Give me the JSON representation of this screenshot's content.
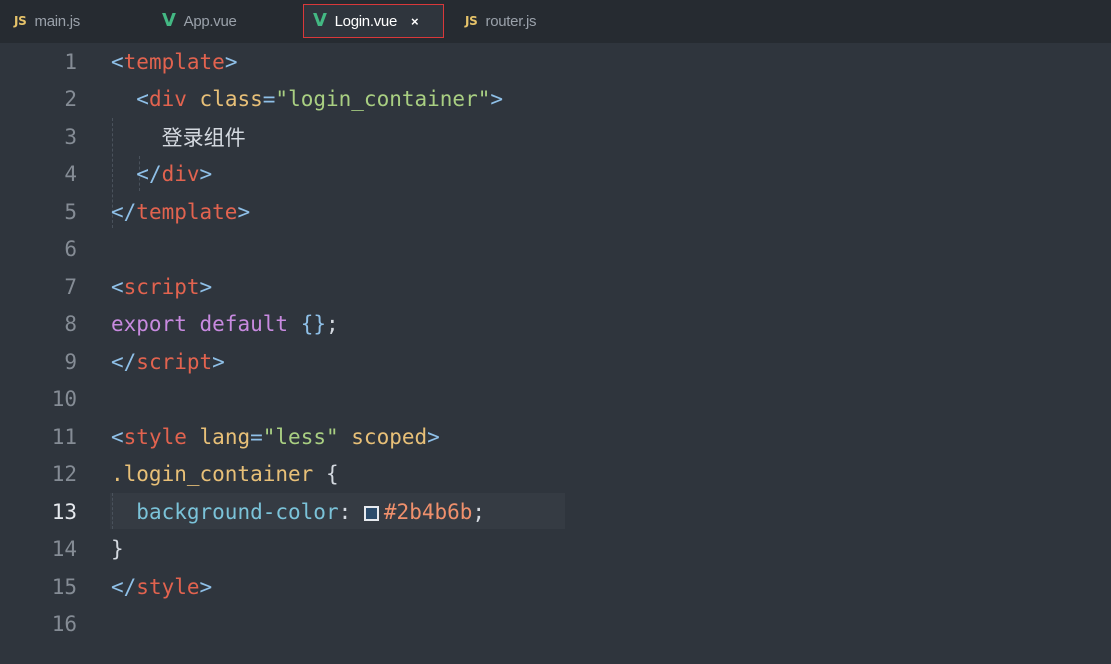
{
  "tabs": [
    {
      "label": "main.js",
      "icon": "JS",
      "active": false
    },
    {
      "label": "App.vue",
      "icon": "V",
      "active": false
    },
    {
      "label": "Login.vue",
      "icon": "V",
      "active": true,
      "close": "×"
    },
    {
      "label": "router.js",
      "icon": "JS",
      "active": false
    }
  ],
  "editor": {
    "current_line": "13",
    "line_numbers": [
      "1",
      "2",
      "3",
      "4",
      "5",
      "6",
      "7",
      "8",
      "9",
      "10",
      "11",
      "12",
      "13",
      "14",
      "15",
      "16"
    ],
    "lines": {
      "l1": {
        "lt": "<",
        "tag": "template",
        "gt": ">"
      },
      "l2": {
        "lt": "<",
        "tag": "div",
        "attr": "class",
        "eq": "=",
        "val": "\"login_container\"",
        "gt": ">"
      },
      "l3": {
        "text": "登录组件"
      },
      "l4": {
        "lt": "</",
        "tag": "div",
        "gt": ">"
      },
      "l5": {
        "lt": "</",
        "tag": "template",
        "gt": ">"
      },
      "l7": {
        "lt": "<",
        "tag": "script",
        "gt": ">"
      },
      "l8": {
        "kw1": "export",
        "kw2": "default",
        "obj": "{}",
        "semi": ";"
      },
      "l9": {
        "lt": "</",
        "tag": "script",
        "gt": ">"
      },
      "l11": {
        "lt": "<",
        "tag": "style",
        "attr1": "lang",
        "eq": "=",
        "val": "\"less\"",
        "attr2": "scoped",
        "gt": ">"
      },
      "l12": {
        "sel": ".login_container",
        "brace": "{"
      },
      "l13": {
        "prop": "background-color",
        "colon": ":",
        "value": "#2b4b6b",
        "semi": ";"
      },
      "l14": {
        "brace": "}"
      },
      "l15": {
        "lt": "</",
        "tag": "style",
        "gt": ">"
      }
    },
    "swatch_color": "#2b4b6b"
  }
}
